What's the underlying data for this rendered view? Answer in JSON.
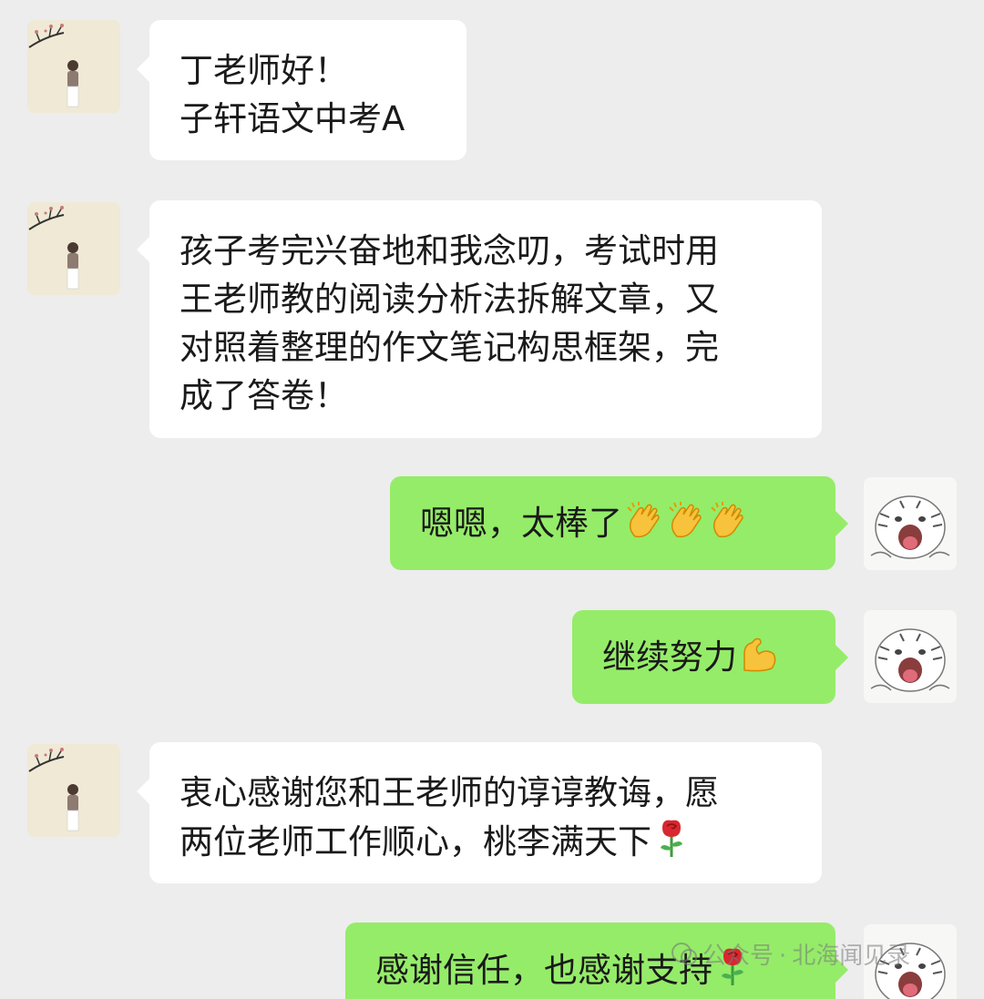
{
  "messages": [
    {
      "sender": "parent",
      "lines": [
        "丁老师好！",
        "子轩语文中考A"
      ]
    },
    {
      "sender": "parent",
      "lines": [
        "孩子考完兴奋地和我念叨，考试时用",
        "王老师教的阅读分析法拆解文章，又",
        "对照着整理的作文笔记构思框架，完",
        "成了答卷！"
      ]
    },
    {
      "sender": "teacher",
      "text": "嗯嗯，太棒了",
      "emojis": [
        "clapping-hands",
        "clapping-hands",
        "clapping-hands"
      ]
    },
    {
      "sender": "teacher",
      "text": "继续努力",
      "emojis": [
        "flexed-biceps"
      ]
    },
    {
      "sender": "parent",
      "lines": [
        "衷心感谢您和王老师的谆谆教诲，愿",
        "两位老师工作顺心，桃李满天下"
      ],
      "emojis": [
        "rose"
      ]
    },
    {
      "sender": "teacher",
      "text": "感谢信任，也感谢支持",
      "emojis": [
        "rose"
      ]
    }
  ],
  "watermark": {
    "label": "公众号",
    "separator": "·",
    "account": "北海闻见录"
  },
  "colors": {
    "background": "#ededed",
    "incoming_bubble": "#ffffff",
    "outgoing_bubble": "#95ec69",
    "text": "#1a1a1a"
  },
  "avatars": {
    "parent": "girl-with-flower-branch-avatar",
    "teacher": "white-tiger-avatar"
  }
}
